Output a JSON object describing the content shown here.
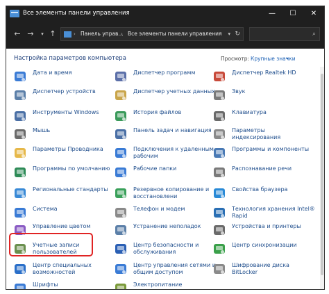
{
  "window": {
    "title": "Все элементы панели управления",
    "minimize_glyph": "—",
    "maximize_glyph": "☐",
    "close_glyph": "✕"
  },
  "address": {
    "back_glyph": "←",
    "forward_glyph": "→",
    "dropdown_glyph": "▾",
    "up_glyph": "↑",
    "separator": "›",
    "crumbs": [
      "Панель управ...",
      "Все элементы панели управления"
    ],
    "refresh_glyph": "↻",
    "search_placeholder": "",
    "search_glyph": "⌕"
  },
  "header": {
    "title": "Настройка параметров компьютера",
    "view_label": "Просмотр:",
    "view_value": "Крупные значки",
    "view_caret": "▾"
  },
  "items": [
    {
      "label": "Дата и время",
      "icon": "clock-icon",
      "color": "#3a7bd5"
    },
    {
      "label": "Диспетчер устройств",
      "icon": "device-manager-icon",
      "color": "#5b7fa8"
    },
    {
      "label": "Инструменты Windows",
      "icon": "tools-icon",
      "color": "#4a6fa5"
    },
    {
      "label": "Мышь",
      "icon": "mouse-icon",
      "color": "#6b6b6b"
    },
    {
      "label": "Параметры Проводника",
      "icon": "folder-icon",
      "color": "#e6b84a"
    },
    {
      "label": "Программы по умолчанию",
      "icon": "default-programs-icon",
      "color": "#2e8b57"
    },
    {
      "label": "Региональные стандарты",
      "icon": "globe-icon",
      "color": "#3a8ad6"
    },
    {
      "label": "Система",
      "icon": "monitor-icon",
      "color": "#3a7bd5"
    },
    {
      "label": "Управление цветом",
      "icon": "color-management-icon",
      "color": "#8a5bc4"
    },
    {
      "label": "Учетные записи пользователей",
      "icon": "users-icon",
      "color": "#6a8f4e"
    },
    {
      "label": "Центр специальных возможностей",
      "icon": "accessibility-icon",
      "color": "#2a6fc9"
    },
    {
      "label": "Шрифты",
      "icon": "fonts-icon",
      "color": "#3a7bd5"
    },
    {
      "label": "Диспетчер программ",
      "icon": "program-manager-icon",
      "color": "#5b6fa8"
    },
    {
      "label": "Диспетчер учетных данных",
      "icon": "credentials-icon",
      "color": "#c9a54a"
    },
    {
      "label": "История файлов",
      "icon": "file-history-icon",
      "color": "#3a9a5a"
    },
    {
      "label": "Панель задач и навигация",
      "icon": "taskbar-icon",
      "color": "#4a6fa5"
    },
    {
      "label": "Подключения к удаленным рабочим",
      "icon": "remote-desktop-icon",
      "color": "#3a7bd5"
    },
    {
      "label": "Рабочие папки",
      "icon": "work-folders-icon",
      "color": "#3a7bd5"
    },
    {
      "label": "Резервное копирование и восстановлени",
      "icon": "backup-icon",
      "color": "#3aa05a"
    },
    {
      "label": "Телефон и модем",
      "icon": "phone-icon",
      "color": "#8a8a8a"
    },
    {
      "label": "Устранение неполадок",
      "icon": "troubleshoot-icon",
      "color": "#5b7fa8"
    },
    {
      "label": "Центр безопасности и обслуживания",
      "icon": "security-flag-icon",
      "color": "#2a5fb4"
    },
    {
      "label": "Центр управления сетями и общим доступом",
      "icon": "network-icon",
      "color": "#3a7bd5"
    },
    {
      "label": "Электропитание",
      "icon": "power-icon",
      "color": "#7a9a3a"
    },
    {
      "label": "Диспетчер Realtek HD",
      "icon": "realtek-icon",
      "color": "#c84a3a"
    },
    {
      "label": "Звук",
      "icon": "sound-icon",
      "color": "#7a7a7a"
    },
    {
      "label": "Клавиатура",
      "icon": "keyboard-icon",
      "color": "#6a6a6a"
    },
    {
      "label": "Параметры индексирования",
      "icon": "indexing-icon",
      "color": "#8a8a8a"
    },
    {
      "label": "Программы и компоненты",
      "icon": "programs-icon",
      "color": "#4a7ab5"
    },
    {
      "label": "Распознавание речи",
      "icon": "microphone-icon",
      "color": "#7a7a7a"
    },
    {
      "label": "Свойства браузера",
      "icon": "browser-icon",
      "color": "#2a8ad6"
    },
    {
      "label": "Технология хранения Intel® Rapid",
      "icon": "intel-storage-icon",
      "color": "#2a6fb4"
    },
    {
      "label": "Устройства и принтеры",
      "icon": "printer-icon",
      "color": "#6a6a6a"
    },
    {
      "label": "Центр синхронизации",
      "icon": "sync-icon",
      "color": "#3aa04a"
    },
    {
      "label": "Шифрование диска BitLocker",
      "icon": "bitlocker-icon",
      "color": "#8a8a8a"
    }
  ]
}
